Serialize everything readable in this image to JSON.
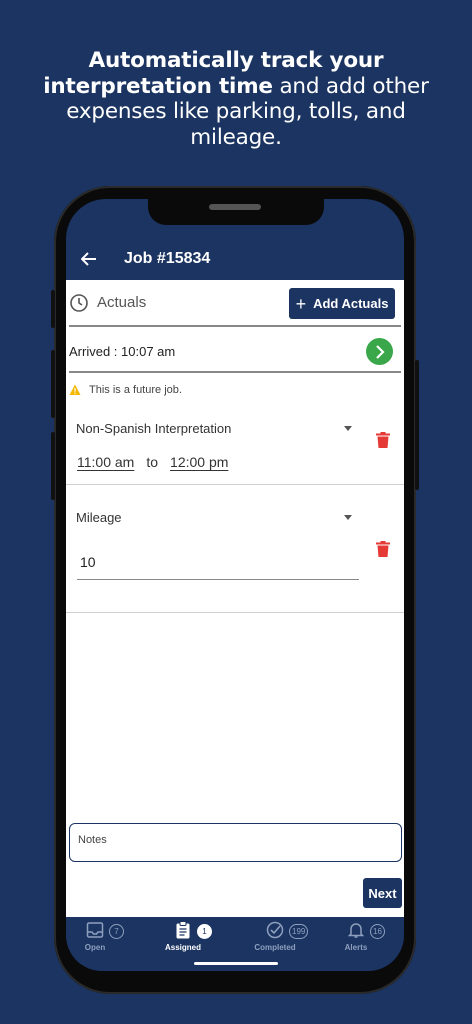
{
  "promo": {
    "bold_text": "Automatically track your interpretation time",
    "normal_text": " and add other expenses like parking, tolls, and mileage."
  },
  "header": {
    "back_icon": "arrow-left-icon",
    "title": "Job #15834"
  },
  "actuals": {
    "label": "Actuals",
    "add_button_label": "Add Actuals"
  },
  "arrived": {
    "text": "Arrived : 10:07 am"
  },
  "warning": {
    "text": "This is a future job.",
    "color": "#f5b800"
  },
  "entries": [
    {
      "type": "Non-Spanish Interpretation",
      "start_time": "11:00 am",
      "to_label": "to",
      "end_time": "12:00 pm"
    },
    {
      "type": "Mileage",
      "value": "10"
    }
  ],
  "notes": {
    "placeholder": "Notes"
  },
  "next_button_label": "Next",
  "bottom_nav": [
    {
      "label": "Open",
      "badge": "7",
      "icon": "inbox-icon",
      "active": false
    },
    {
      "label": "Assigned",
      "badge": "1",
      "icon": "clipboard-icon",
      "active": true
    },
    {
      "label": "Completed",
      "badge": "199",
      "icon": "check-circle-icon",
      "active": false
    },
    {
      "label": "Alerts",
      "badge": "16",
      "icon": "bell-icon",
      "active": false
    }
  ],
  "colors": {
    "brand_navy": "#1b3461",
    "go_green": "#3aa84a",
    "delete_red": "#e53935"
  }
}
